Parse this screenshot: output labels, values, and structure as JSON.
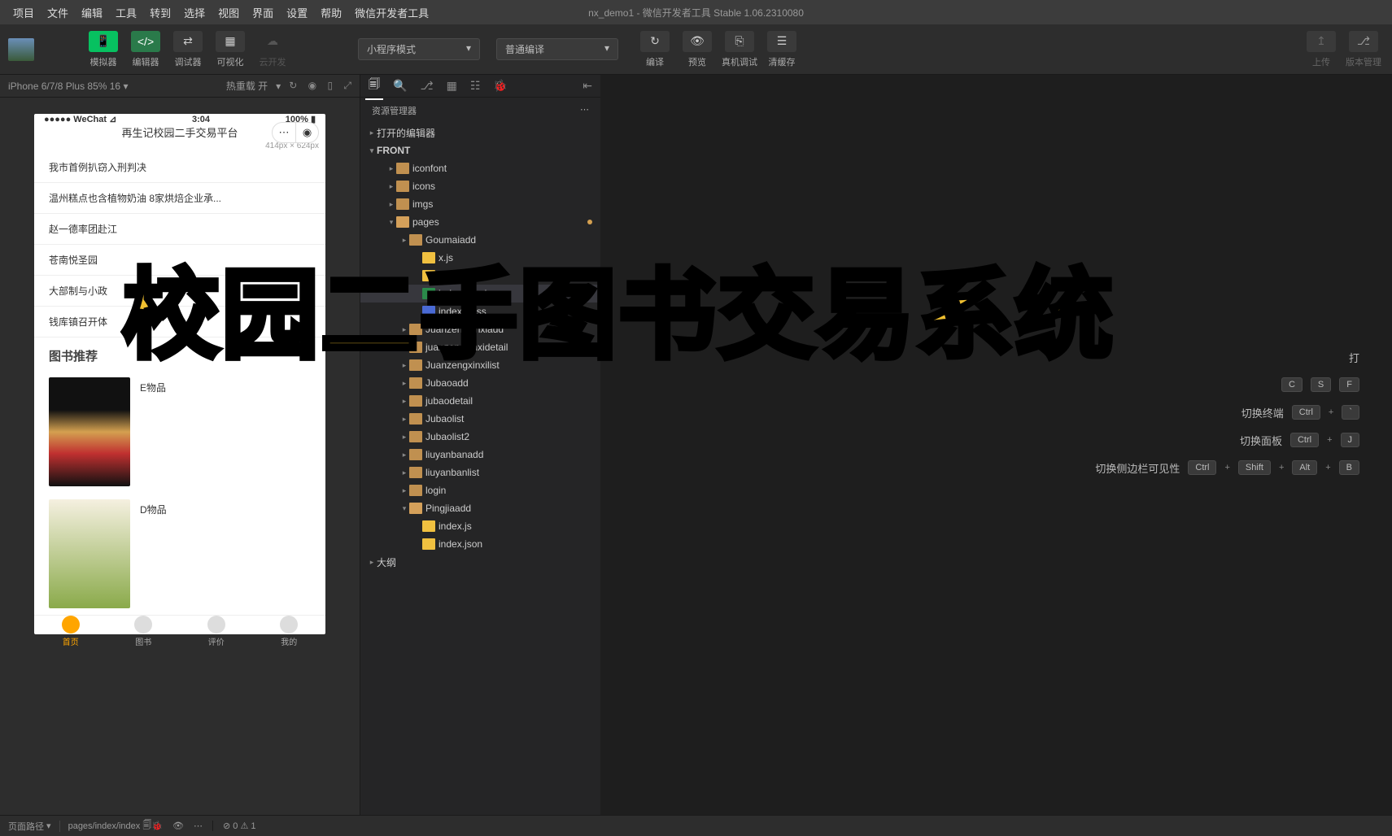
{
  "window_title": "nx_demo1 - 微信开发者工具 Stable 1.06.2310080",
  "menu": [
    "项目",
    "文件",
    "编辑",
    "工具",
    "转到",
    "选择",
    "视图",
    "界面",
    "设置",
    "帮助",
    "微信开发者工具"
  ],
  "toolbar": {
    "simulator": "模拟器",
    "editor": "编辑器",
    "debugger": "调试器",
    "visual": "可视化",
    "cloud": "云开发",
    "mode": "小程序模式",
    "compile_mode": "普通编译",
    "compile": "编译",
    "preview": "预览",
    "remote": "真机调试",
    "cache": "清缓存",
    "upload": "上传",
    "version": "版本管理"
  },
  "sim": {
    "device": "iPhone 6/7/8 Plus 85% 16",
    "hot": "热重载 开",
    "wechat": "WeChat",
    "time": "3:04",
    "battery": "100%",
    "app_title": "再生记校园二手交易平台",
    "dim": "414px × 624px",
    "news": [
      "我市首例扒窃入刑判决",
      "温州糕点也含植物奶油 8家烘焙企业承...",
      "赵一德率团赴江",
      "苍南悦圣园",
      "大部制与小政",
      "钱库镇召开体"
    ],
    "section": "图书推荐",
    "book1": "E物品",
    "book2": "D物品",
    "tabs": [
      "首页",
      "图书",
      "评价",
      "我的"
    ]
  },
  "explorer": {
    "title": "资源管理器",
    "editors": "打开的编辑器",
    "root": "FRONT",
    "items": [
      {
        "name": "iconfont",
        "type": "folder",
        "indent": 2
      },
      {
        "name": "icons",
        "type": "folder",
        "indent": 2
      },
      {
        "name": "imgs",
        "type": "folder",
        "indent": 2
      },
      {
        "name": "pages",
        "type": "folder-open",
        "indent": 2,
        "dot": true
      },
      {
        "name": "Goumaiadd",
        "type": "folder",
        "indent": 3
      },
      {
        "name": "x.js",
        "type": "file-js",
        "indent": 4,
        "partial": true
      },
      {
        "name": "x.json",
        "type": "file-json",
        "indent": 4,
        "partial": true
      },
      {
        "name": "index.wxml",
        "type": "file-wxml",
        "indent": 4,
        "sel": true,
        "badge": "1"
      },
      {
        "name": "index.wxss",
        "type": "file-wxss",
        "indent": 4
      },
      {
        "name": "Juanzengxinxiadd",
        "type": "folder",
        "indent": 3
      },
      {
        "name": "juanzengxinxidetail",
        "type": "folder",
        "indent": 3
      },
      {
        "name": "Juanzengxinxilist",
        "type": "folder",
        "indent": 3
      },
      {
        "name": "Jubaoadd",
        "type": "folder",
        "indent": 3
      },
      {
        "name": "jubaodetail",
        "type": "folder",
        "indent": 3
      },
      {
        "name": "Jubaolist",
        "type": "folder",
        "indent": 3
      },
      {
        "name": "Jubaolist2",
        "type": "folder",
        "indent": 3
      },
      {
        "name": "liuyanbanadd",
        "type": "folder",
        "indent": 3
      },
      {
        "name": "liuyanbanlist",
        "type": "folder",
        "indent": 3
      },
      {
        "name": "login",
        "type": "folder",
        "indent": 3
      },
      {
        "name": "Pingjiaadd",
        "type": "folder-open",
        "indent": 3
      },
      {
        "name": "index.js",
        "type": "file-js",
        "indent": 4
      },
      {
        "name": "index.json",
        "type": "file-json",
        "indent": 4
      }
    ],
    "outline": "大纲"
  },
  "palette": {
    "rows": [
      {
        "label": "打",
        "keys": []
      },
      {
        "label": "",
        "keys": [
          "C",
          "S",
          "F"
        ]
      },
      {
        "label": "切换终端",
        "keys": [
          "Ctrl",
          "`"
        ]
      },
      {
        "label": "切换面板",
        "keys": [
          "Ctrl",
          "J"
        ]
      },
      {
        "label": "切换侧边栏可见性",
        "keys": [
          "Ctrl",
          "Shift",
          "Alt",
          "B"
        ]
      }
    ]
  },
  "status": {
    "path_label": "页面路径",
    "path": "pages/index/index",
    "errors": "0",
    "warnings": "1"
  },
  "overlay": "校园二手图书交易系统"
}
